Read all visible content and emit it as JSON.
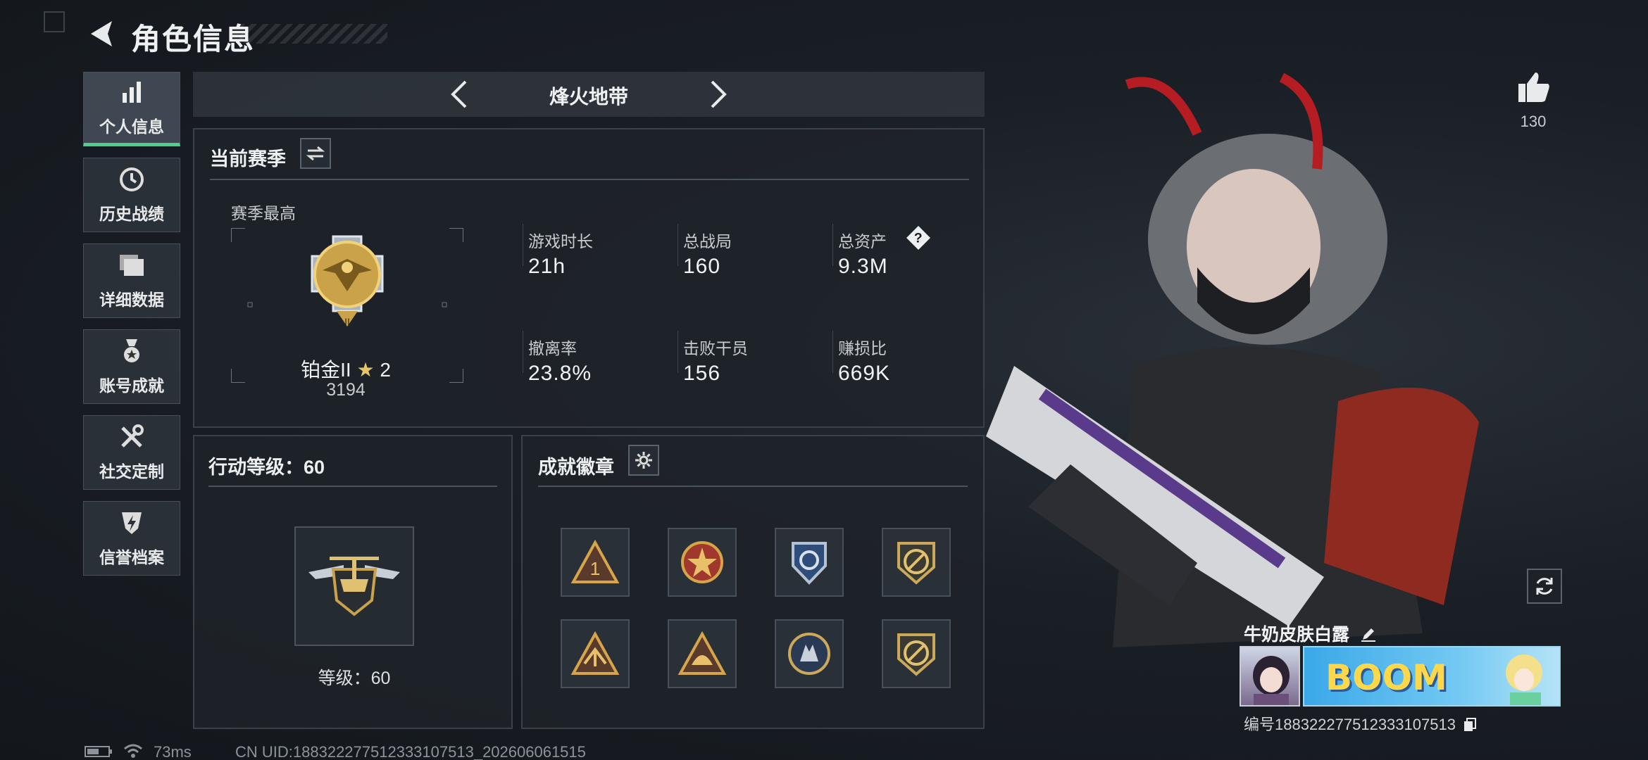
{
  "header": {
    "title": "角色信息"
  },
  "sidebar": {
    "items": [
      {
        "label": "个人信息",
        "icon": "bar-chart-icon"
      },
      {
        "label": "历史战绩",
        "icon": "history-icon"
      },
      {
        "label": "详细数据",
        "icon": "folder-icon"
      },
      {
        "label": "账号成就",
        "icon": "medal-icon"
      },
      {
        "label": "社交定制",
        "icon": "tools-icon"
      },
      {
        "label": "信誉档案",
        "icon": "shield-bolt-icon"
      }
    ]
  },
  "mode": {
    "name": "烽火地带"
  },
  "season": {
    "title": "当前赛季",
    "best_label": "赛季最高",
    "rank_name": "铂金II",
    "rank_stars": "2",
    "rank_score": "3194",
    "stats": [
      {
        "label": "游戏时长",
        "value": "21h"
      },
      {
        "label": "总战局",
        "value": "160"
      },
      {
        "label": "总资产",
        "value": "9.3M"
      },
      {
        "label": "撤离率",
        "value": "23.8%"
      },
      {
        "label": "击败干员",
        "value": "156"
      },
      {
        "label": "赚损比",
        "value": "669K"
      }
    ],
    "help_glyph": "?"
  },
  "level": {
    "title": "行动等级：60",
    "caption": "等级：60"
  },
  "badges": {
    "title": "成就徽章",
    "items": [
      "rank-one-badge-icon",
      "star-cross-badge-icon",
      "wing-shield-badge-icon",
      "no-gun-badge-icon",
      "scorpion-badge-icon",
      "helmet-badge-icon",
      "wolf-badge-icon",
      "no-gun-badge-2-icon"
    ]
  },
  "social": {
    "like_count": "130"
  },
  "player": {
    "name": "牛奶皮肤白露",
    "uid_line": "编号1883222775123331075​13",
    "banner_text": "BOOM"
  },
  "footer": {
    "ping": "73ms",
    "uid": "CN UID:1883222775123331075​13_202606061515"
  },
  "colors": {
    "accent": "#4fd08a",
    "gold": "#c9a24a"
  }
}
